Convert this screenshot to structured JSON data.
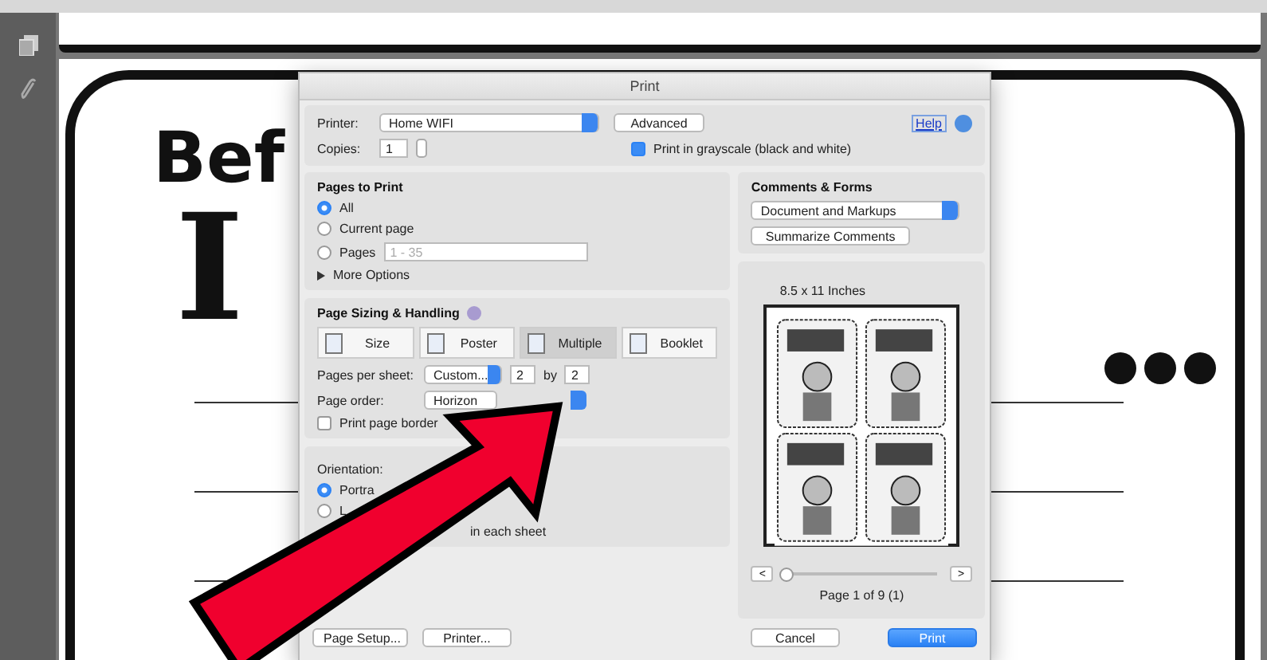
{
  "document": {
    "heading": "Bef",
    "letter": "I"
  },
  "dialog": {
    "title": "Print",
    "printer": {
      "label": "Printer:",
      "value": "Home WIFI"
    },
    "advanced_button": "Advanced",
    "help_link": "Help",
    "copies": {
      "label": "Copies:",
      "value": "1"
    },
    "grayscale": {
      "label": "Print in grayscale (black and white)",
      "checked": true
    },
    "pages_to_print": {
      "title": "Pages to Print",
      "options": [
        {
          "label": "All",
          "selected": true
        },
        {
          "label": "Current page",
          "selected": false
        },
        {
          "label": "Pages",
          "selected": false,
          "placeholder": "1 - 35"
        }
      ],
      "more_options": {
        "label": "More Options",
        "expanded": false
      }
    },
    "page_sizing": {
      "title": "Page Sizing & Handling",
      "modes": [
        {
          "label": "Size",
          "selected": false
        },
        {
          "label": "Poster",
          "selected": false
        },
        {
          "label": "Multiple",
          "selected": true
        },
        {
          "label": "Booklet",
          "selected": false
        }
      ],
      "pages_per_sheet": {
        "label": "Pages per sheet:",
        "value": "Custom...",
        "columns": "2",
        "by": "by",
        "rows": "2"
      },
      "page_order": {
        "label": "Page order:",
        "value": "Horizon"
      },
      "print_page_border": {
        "label": "Print page border",
        "checked": false
      }
    },
    "orientation": {
      "title": "Orientation:",
      "options": [
        {
          "label": "Portra",
          "selected": true
        },
        {
          "label": "L",
          "selected": false
        }
      ],
      "note": "in each sheet"
    },
    "comments_forms": {
      "title": "Comments & Forms",
      "value": "Document and Markups",
      "button": "Summarize Comments"
    },
    "preview": {
      "size": "8.5 x 11 Inches",
      "prev": "<",
      "next": ">",
      "level": 0,
      "page_label": "Page 1 of 9 (1)"
    },
    "footer_left": [
      "Page Setup...",
      "Printer..."
    ],
    "footer_right": [
      {
        "label": "Cancel",
        "kind": "default"
      },
      {
        "label": "Print",
        "kind": "primary"
      }
    ]
  }
}
